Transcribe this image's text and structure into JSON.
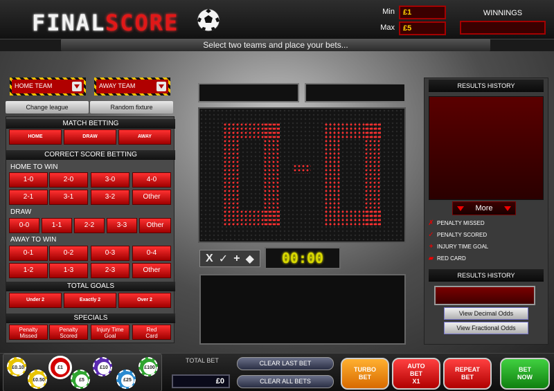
{
  "header": {
    "logo_final": "FINAL",
    "logo_score": "SCORE",
    "min_label": "Min",
    "min_value": "£1",
    "max_label": "Max",
    "max_value": "£5",
    "winnings_label": "WINNINGS",
    "winnings_value": ""
  },
  "instruction": "Select two teams and place your bets...",
  "team_select": {
    "home_label": "HOME TEAM",
    "away_label": "AWAY TEAM",
    "change_league_label": "Change league",
    "random_fixture_label": "Random fixture"
  },
  "match_betting": {
    "title": "MATCH BETTING",
    "options": [
      "HOME",
      "DRAW",
      "AWAY"
    ]
  },
  "correct_score": {
    "title": "CORRECT SCORE BETTING",
    "home_to_win_label": "HOME TO WIN",
    "home_to_win": [
      "1-0",
      "2-0",
      "3-0",
      "4-0",
      "2-1",
      "3-1",
      "3-2",
      "Other"
    ],
    "draw_label": "DRAW",
    "draw": [
      "0-0",
      "1-1",
      "2-2",
      "3-3",
      "Other"
    ],
    "away_to_win_label": "AWAY TO WIN",
    "away_to_win": [
      "0-1",
      "0-2",
      "0-3",
      "0-4",
      "1-2",
      "1-3",
      "2-3",
      "Other"
    ]
  },
  "total_goals": {
    "title": "TOTAL GOALS",
    "options": [
      "Under 2",
      "Exactly 2",
      "Over 2"
    ]
  },
  "specials": {
    "title": "SPECIALS",
    "options": [
      {
        "line1": "Penalty",
        "line2": "Missed"
      },
      {
        "line1": "Penalty",
        "line2": "Scored"
      },
      {
        "line1": "Injury Time",
        "line2": "Goal"
      },
      {
        "line1": "Red",
        "line2": "Card"
      }
    ]
  },
  "scoreboard": {
    "home_team": "",
    "away_team": "",
    "home_score": "0",
    "away_score": "0",
    "separator": "-",
    "timer": "00:00",
    "symbols": [
      "X",
      "✓",
      "+",
      "◆"
    ],
    "score_color": "#ff3030"
  },
  "results": {
    "title": "RESULTS HISTORY",
    "more_label": "More",
    "legend": [
      {
        "icon": "cross-icon",
        "glyph": "✗",
        "label": "PENALTY MISSED"
      },
      {
        "icon": "tick-icon",
        "glyph": "✓",
        "label": "PENALTY SCORED"
      },
      {
        "icon": "plus-icon",
        "glyph": "+",
        "label": "INJURY TIME GOAL"
      },
      {
        "icon": "red-card-icon",
        "glyph": "▰",
        "label": "RED CARD"
      }
    ],
    "title2": "RESULTS HISTORY",
    "decimal_odds_label": "View Decimal Odds",
    "fractional_odds_label": "View Fractional Odds"
  },
  "footer": {
    "chips": [
      {
        "label": "£0.10",
        "color": "#e8c400"
      },
      {
        "label": "£0.50",
        "color": "#e8c400"
      },
      {
        "label": "£1",
        "color": "#d40000",
        "selected": true
      },
      {
        "label": "£5",
        "color": "#2fa52f"
      },
      {
        "label": "£10",
        "color": "#5a2ab0"
      },
      {
        "label": "£25",
        "color": "#2a8ad0"
      },
      {
        "label": "£100",
        "color": "#2fa52f"
      }
    ],
    "total_bet_label": "TOTAL BET",
    "total_bet_value": "£0",
    "clear_last_bet_label": "CLEAR LAST BET",
    "clear_all_bets_label": "CLEAR ALL BETS",
    "turbo_line1": "TURBO",
    "turbo_line2": "BET",
    "auto_line1": "AUTO",
    "auto_line2": "BET",
    "auto_line3": "X1",
    "repeat_line1": "REPEAT",
    "repeat_line2": "BET",
    "bet_now_line1": "BET",
    "bet_now_line2": "NOW"
  },
  "colors": {
    "accent_red": "#e00000",
    "turbo_orange": "#f08a00",
    "bet_now_green": "#1a9a1a",
    "timer_yellow": "#d8d800"
  }
}
